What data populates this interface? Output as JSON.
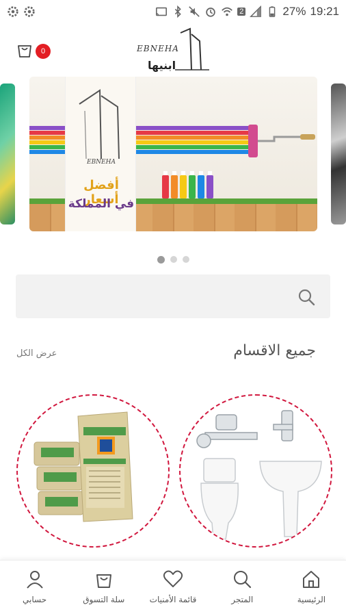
{
  "status_bar": {
    "battery": "27%",
    "time": "19:21",
    "sim_badge": "2"
  },
  "header": {
    "cart_count": "0",
    "logo_en": "EBNEHA",
    "logo_ar": "ابنيها"
  },
  "banner": {
    "brand": "EBNEHA",
    "line1": "أفضل أسعار",
    "line2": "في المملكة",
    "stripe_colors": [
      "#8a4fc7",
      "#e63946",
      "#f28c28",
      "#f6c915",
      "#3ab54a",
      "#1e88e5"
    ]
  },
  "carousel": {
    "page_count": 3,
    "active_index": 0
  },
  "search": {
    "placeholder": ""
  },
  "categories_section": {
    "title": "جميع الاقسام",
    "view_all": "عرض الكل"
  },
  "categories": [
    {
      "icon": "sanitary-ware-image"
    },
    {
      "icon": "cement-bags-image"
    }
  ],
  "bottom_nav": {
    "items": [
      {
        "label": "حسابي",
        "icon": "user-icon"
      },
      {
        "label": "سلة التسوق",
        "icon": "cart-icon"
      },
      {
        "label": "قائمة الأمنيات",
        "icon": "heart-icon"
      },
      {
        "label": "المتجر",
        "icon": "search-icon"
      },
      {
        "label": "الرئيسية",
        "icon": "home-icon"
      }
    ]
  },
  "colors": {
    "accent": "#e31e24",
    "category_border": "#d1173e"
  }
}
